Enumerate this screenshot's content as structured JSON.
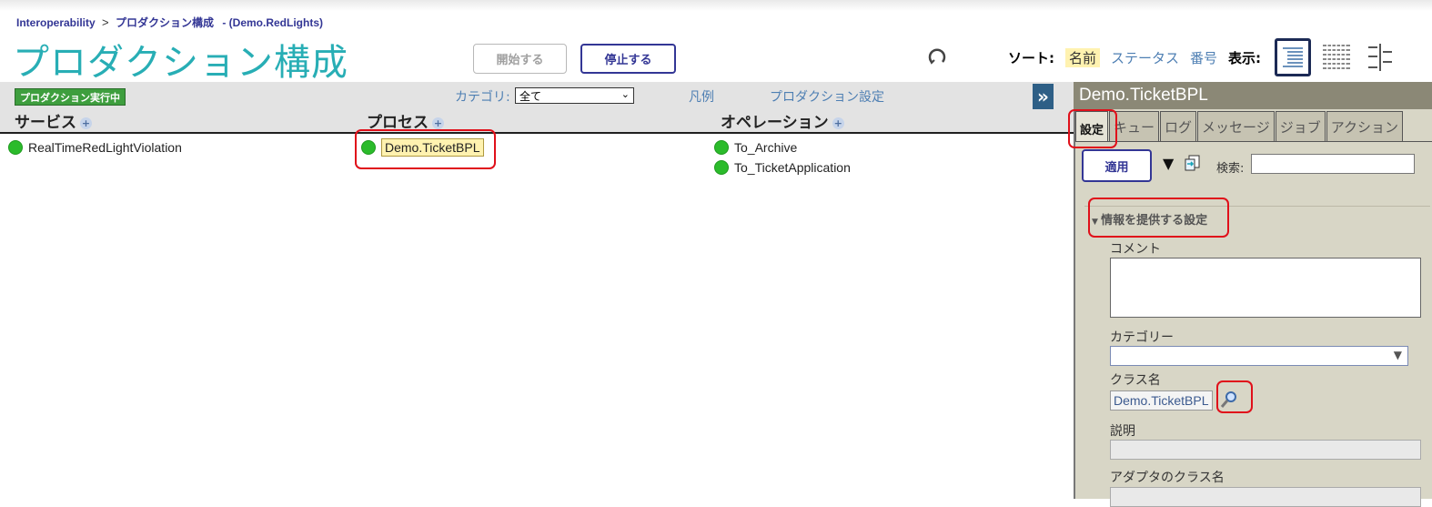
{
  "breadcrumb": {
    "root": "Interoperability",
    "separator": ">",
    "page": "プロダクション構成",
    "current": "- (Demo.RedLights)"
  },
  "page_title": "プロダクション構成",
  "buttons": {
    "start": "開始する",
    "stop": "停止する"
  },
  "sort": {
    "label": "ソート:",
    "options": [
      "名前",
      "ステータス",
      "番号"
    ],
    "active": "名前",
    "view_label": "表示:"
  },
  "toolbar": {
    "status_badge": "プロダクション実行中",
    "category_label": "カテゴリ:",
    "category_value": "全て",
    "legend": "凡例",
    "production_settings": "プロダクション設定",
    "expand": "»"
  },
  "columns": {
    "services": {
      "header": "サービス",
      "items": [
        "RealTimeRedLightViolation"
      ]
    },
    "processes": {
      "header": "プロセス",
      "items": [
        "Demo.TicketBPL"
      ]
    },
    "operations": {
      "header": "オペレーション",
      "items": [
        "To_Archive",
        "To_TicketApplication"
      ]
    }
  },
  "panel": {
    "title": "Demo.TicketBPL",
    "tabs": [
      "設定",
      "キュー",
      "ログ",
      "メッセージ",
      "ジョブ",
      "アクション"
    ],
    "apply": "適用",
    "search_label": "検索:",
    "section": "情報を提供する設定",
    "fields": {
      "comment": "コメント",
      "category": "カテゴリー",
      "classname_label": "クラス名",
      "classname_value": "Demo.TicketBPL",
      "description": "説明",
      "adapter_class": "アダプタのクラス名"
    }
  },
  "colors": {
    "title": "#28aeb5",
    "link": "#4e7fb3",
    "status_green": "#2bbb2b",
    "highlight_red": "#e0101a"
  }
}
